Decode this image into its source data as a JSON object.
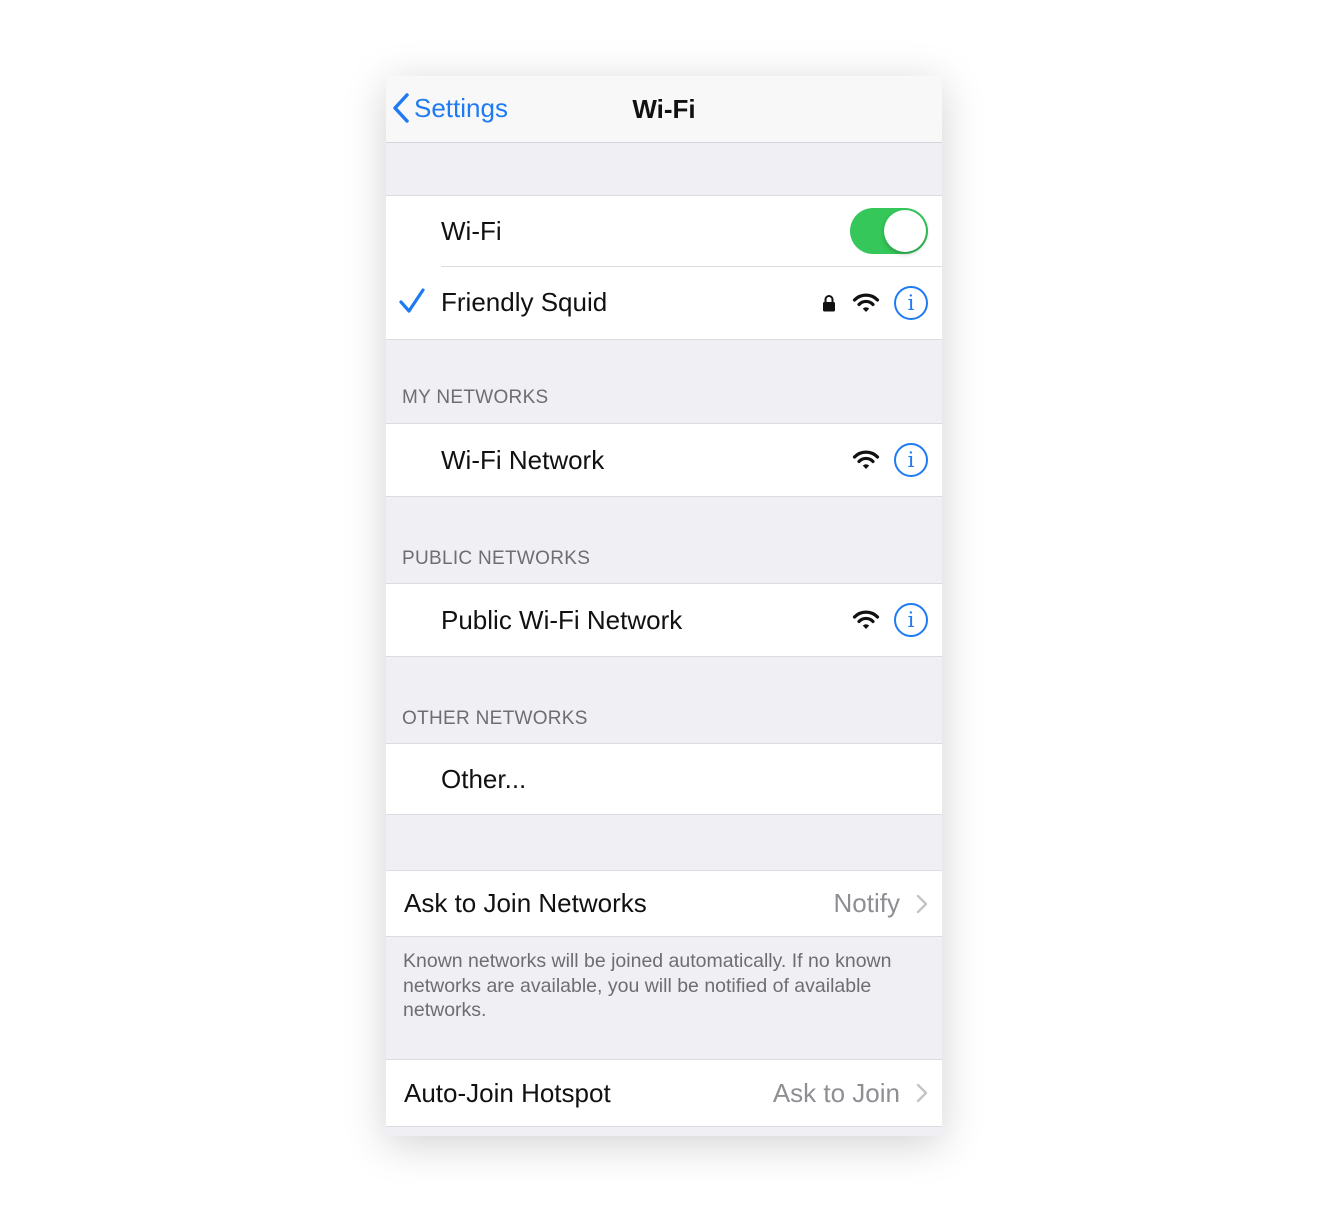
{
  "nav": {
    "back_label": "Settings",
    "title": "Wi-Fi"
  },
  "wifi": {
    "label": "Wi-Fi",
    "enabled": true
  },
  "connected": {
    "name": "Friendly Squid",
    "locked": true
  },
  "my_networks": {
    "header": "MY NETWORKS",
    "items": [
      {
        "name": "Wi-Fi Network"
      }
    ]
  },
  "public_networks": {
    "header": "PUBLIC NETWORKS",
    "items": [
      {
        "name": "Public Wi-Fi Network"
      }
    ]
  },
  "other_networks": {
    "header": "OTHER NETWORKS",
    "other_label": "Other..."
  },
  "ask_to_join": {
    "label": "Ask to Join Networks",
    "value": "Notify",
    "footnote": "Known networks will be joined automatically. If no known networks are available, you will be notified of available networks."
  },
  "auto_join": {
    "label": "Auto-Join Hotspot",
    "value": "Ask to Join"
  },
  "colors": {
    "accent": "#1e7bf2",
    "toggle_on": "#35c759",
    "background": "#efeff4"
  },
  "icons": [
    "chevron-left-icon",
    "checkmark-icon",
    "lock-icon",
    "wifi-icon",
    "info-icon",
    "chevron-right-icon"
  ]
}
